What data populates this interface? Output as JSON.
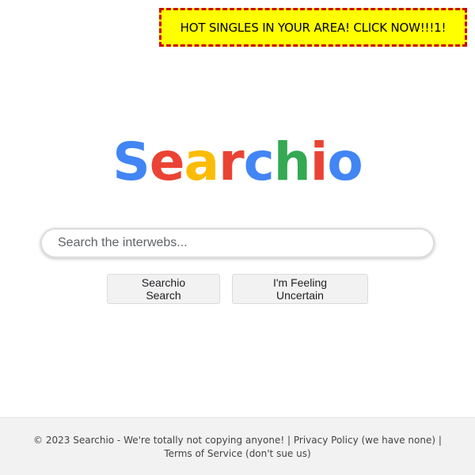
{
  "ad_banner": {
    "text": "HOT SINGLES IN YOUR AREA! CLICK NOW!!!1!",
    "background_color": "#ffff00",
    "border_color": "#cc0000"
  },
  "logo": {
    "letters": [
      {
        "char": "S",
        "color": "#4285f4"
      },
      {
        "char": "e",
        "color": "#ea4335"
      },
      {
        "char": "a",
        "color": "#fbbc05"
      },
      {
        "char": "r",
        "color": "#ea4335"
      },
      {
        "char": "c",
        "color": "#4285f4"
      },
      {
        "char": "h",
        "color": "#34a853"
      },
      {
        "char": "i",
        "color": "#ea4335"
      },
      {
        "char": "o",
        "color": "#4285f4"
      }
    ]
  },
  "search": {
    "placeholder": "Search the interwebs...",
    "value": ""
  },
  "buttons": {
    "search_label": "Searchio Search",
    "lucky_label": "I'm Feeling Uncertain"
  },
  "footer": {
    "copyright": "© 2023 Searchio - We're totally not copying anyone!",
    "separator": "|",
    "privacy_link": "Privacy Policy (we have none)",
    "terms_link": "Terms of Service (don't sue us)"
  }
}
